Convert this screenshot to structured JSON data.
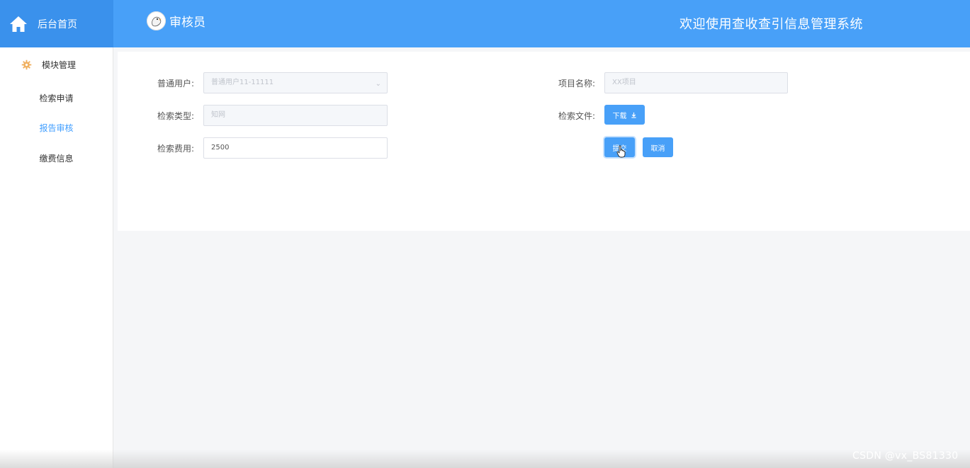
{
  "header": {
    "home_label": "后台首页",
    "role_label": "审核员",
    "system_title": "欢迎使用查收查引信息管理系统",
    "accent_color": "#48a0f8"
  },
  "sidebar": {
    "module_label": "模块管理",
    "items": [
      {
        "label": "检索申请"
      },
      {
        "label": "报告审核"
      },
      {
        "label": "缴费信息"
      }
    ],
    "active_item": "报告审核"
  },
  "form": {
    "user_label": "普通用户:",
    "user_value": "普通用户11-11111",
    "type_label": "检索类型:",
    "type_value": "知网",
    "fee_label": "检索费用:",
    "fee_value": "2500",
    "project_label": "项目名称:",
    "project_value": "XX项目",
    "file_label": "检索文件:",
    "download_label": "下载",
    "submit_label": "提交",
    "cancel_label": "取消"
  },
  "icons": {
    "home": "home-icon",
    "module": "gear-icon",
    "download": "download-icon",
    "select": "chevron-down-icon",
    "cursor": "hand-pointer-icon"
  },
  "watermark": "CSDN @vx_BS81330"
}
